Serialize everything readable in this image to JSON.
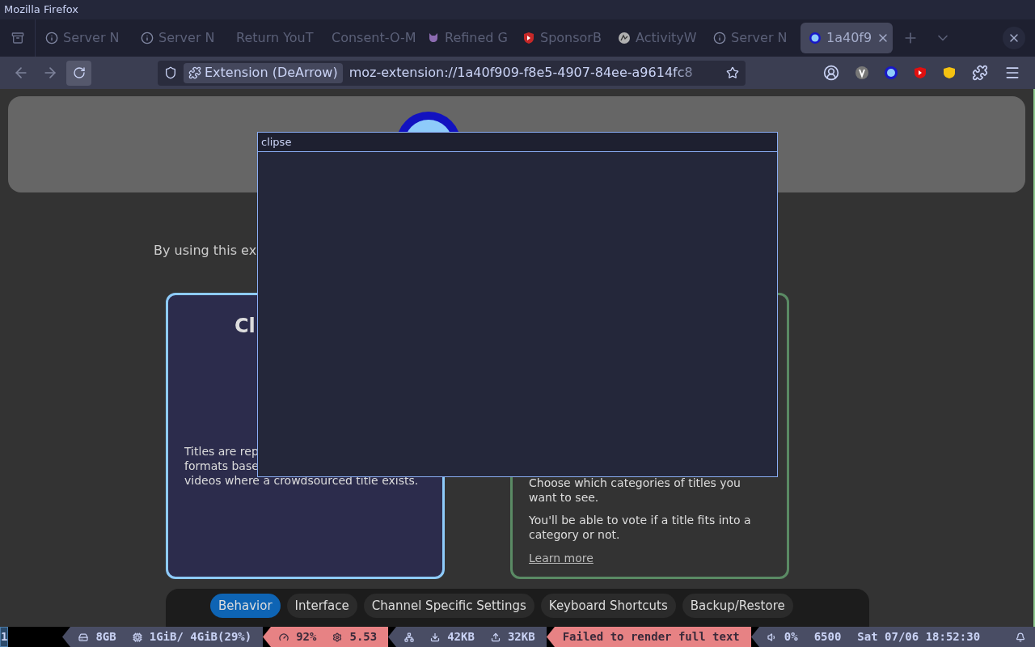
{
  "window": {
    "title": "Mozilla Firefox"
  },
  "tabs": [
    {
      "label": "Server N",
      "kind": "info",
      "selected": false
    },
    {
      "label": "Server N",
      "kind": "info",
      "selected": false
    },
    {
      "label": "Return YouT",
      "kind": "plain",
      "selected": false
    },
    {
      "label": "Consent-O-M",
      "kind": "plain",
      "selected": false
    },
    {
      "label": "Refined G",
      "kind": "cat",
      "selected": false
    },
    {
      "label": "SponsorB",
      "kind": "shield",
      "selected": false
    },
    {
      "label": "ActivityW",
      "kind": "chart",
      "selected": false
    },
    {
      "label": "Server N",
      "kind": "info",
      "selected": false
    },
    {
      "label": "1a40f9",
      "kind": "target",
      "selected": true
    }
  ],
  "toolbar": {
    "identity_chip": "Extension (DeArrow)",
    "url": "moz-extension://1a40f909-f8e5-4907-84ee-a9614fc8",
    "reload_hovered": true
  },
  "page": {
    "notice": "By using this ex",
    "cards": [
      {
        "kind": "blue",
        "title": "Cl",
        "lines": [
          "Titles are rep",
          "formats base",
          "videos where a crowdsourced title exists."
        ]
      },
      {
        "kind": "green",
        "paragraphs": [
          "Choose which categories of titles you want to see.",
          "You'll be able to vote if a title fits into a category or not."
        ],
        "link": "Learn more"
      }
    ],
    "tabs": [
      {
        "label": "Behavior",
        "selected": true
      },
      {
        "label": "Interface",
        "selected": false
      },
      {
        "label": "Channel Specific Settings",
        "selected": false
      },
      {
        "label": "Keyboard Shortcuts",
        "selected": false
      },
      {
        "label": "Backup/Restore",
        "selected": false
      }
    ]
  },
  "popup": {
    "title": "clipse"
  },
  "status_bar": {
    "workspace": "1",
    "segments": [
      {
        "kind": "normal",
        "items": [
          {
            "kind": "disk",
            "text": "8GB"
          },
          {
            "kind": "chip",
            "text": "1GiB/ 4GiB(29%)"
          }
        ]
      },
      {
        "kind": "alert",
        "items": [
          {
            "kind": "gauge",
            "text": "92%"
          },
          {
            "kind": "gear",
            "text": "5.53"
          }
        ]
      },
      {
        "kind": "normal",
        "items": [
          {
            "kind": "net"
          },
          {
            "kind": "down",
            "text": "42KB"
          },
          {
            "kind": "up",
            "text": "32KB"
          }
        ]
      },
      {
        "kind": "alert",
        "items": [
          {
            "kind": "plain",
            "text": "Failed to render full text"
          }
        ]
      },
      {
        "kind": "normal",
        "items": [
          {
            "kind": "speaker",
            "text": "0%"
          },
          {
            "kind": "plain",
            "text": "6500"
          },
          {
            "kind": "plain",
            "text": "Sat 07/06 18:52:30"
          },
          {
            "kind": "bell"
          }
        ]
      }
    ]
  }
}
